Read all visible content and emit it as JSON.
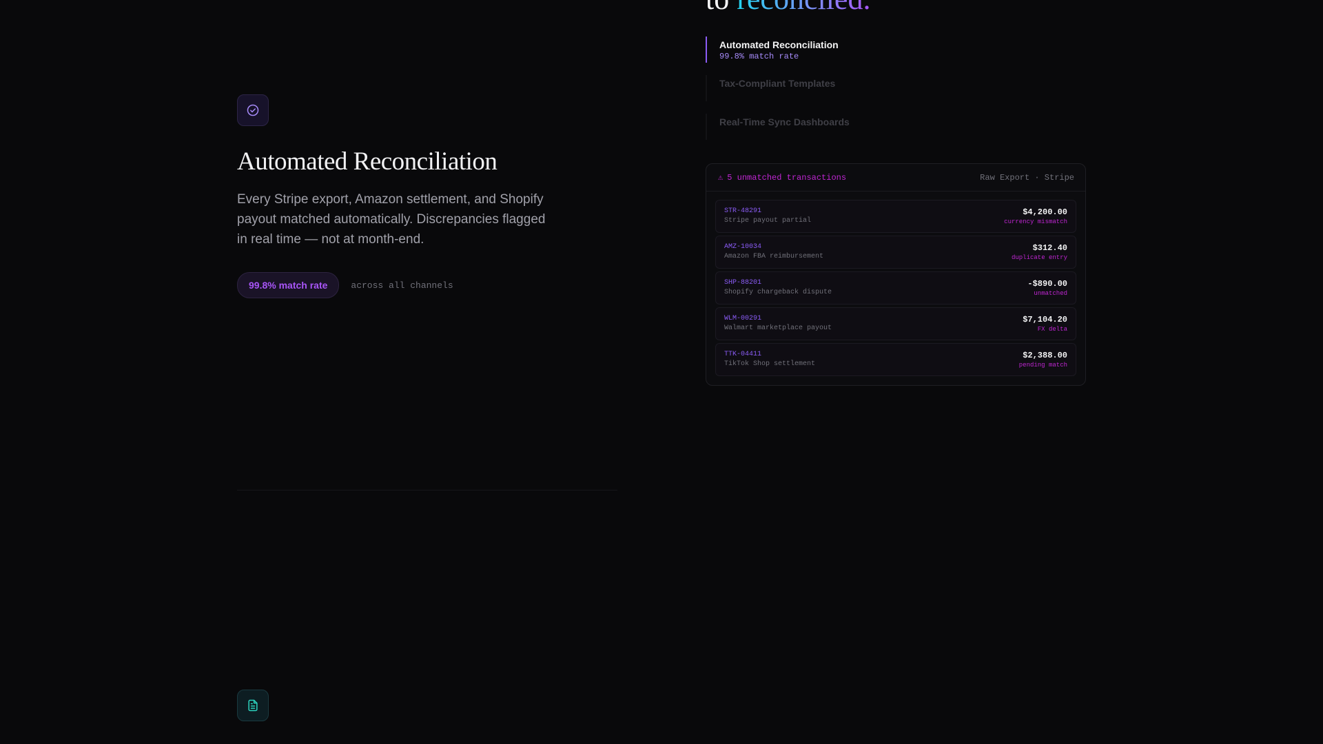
{
  "feature": {
    "icon": "check-circle-icon",
    "title": "Automated Reconciliation",
    "description": "Every Stripe export, Amazon settlement, and Shopify payout matched automatically. Discrepancies flagged in real time — not at month-end.",
    "stat_pill": "99.8% match rate",
    "stat_caption": "across all channels"
  },
  "next_feature": {
    "icon": "document-icon"
  },
  "headline": {
    "lead": "to",
    "accent": "reconciled."
  },
  "tabs": [
    {
      "title": "Automated Reconciliation",
      "subtitle": "99.8% match rate",
      "active": true
    },
    {
      "title": "Tax-Compliant Templates",
      "subtitle": "",
      "active": false
    },
    {
      "title": "Real-Time Sync Dashboards",
      "subtitle": "",
      "active": false
    }
  ],
  "panel": {
    "alert_icon": "warning-icon",
    "alert_symbol": "⚠",
    "alert_text": "5 unmatched transactions",
    "source": "Raw Export · Stripe",
    "rows": [
      {
        "id": "STR-48291",
        "desc": "Stripe payout partial",
        "amount": "$4,200.00",
        "status": "currency mismatch"
      },
      {
        "id": "AMZ-10034",
        "desc": "Amazon FBA reimbursement",
        "amount": "$312.40",
        "status": "duplicate entry"
      },
      {
        "id": "SHP-88201",
        "desc": "Shopify chargeback dispute",
        "amount": "-$890.00",
        "status": "unmatched"
      },
      {
        "id": "WLM-00291",
        "desc": "Walmart marketplace payout",
        "amount": "$7,104.20",
        "status": "FX delta"
      },
      {
        "id": "TTK-04411",
        "desc": "TikTok Shop settlement",
        "amount": "$2,388.00",
        "status": "pending match"
      }
    ]
  },
  "colors": {
    "background": "#09090b",
    "accent_purple": "#8b5cf6",
    "accent_magenta": "#c026d3",
    "accent_teal": "#2dd4bf"
  }
}
